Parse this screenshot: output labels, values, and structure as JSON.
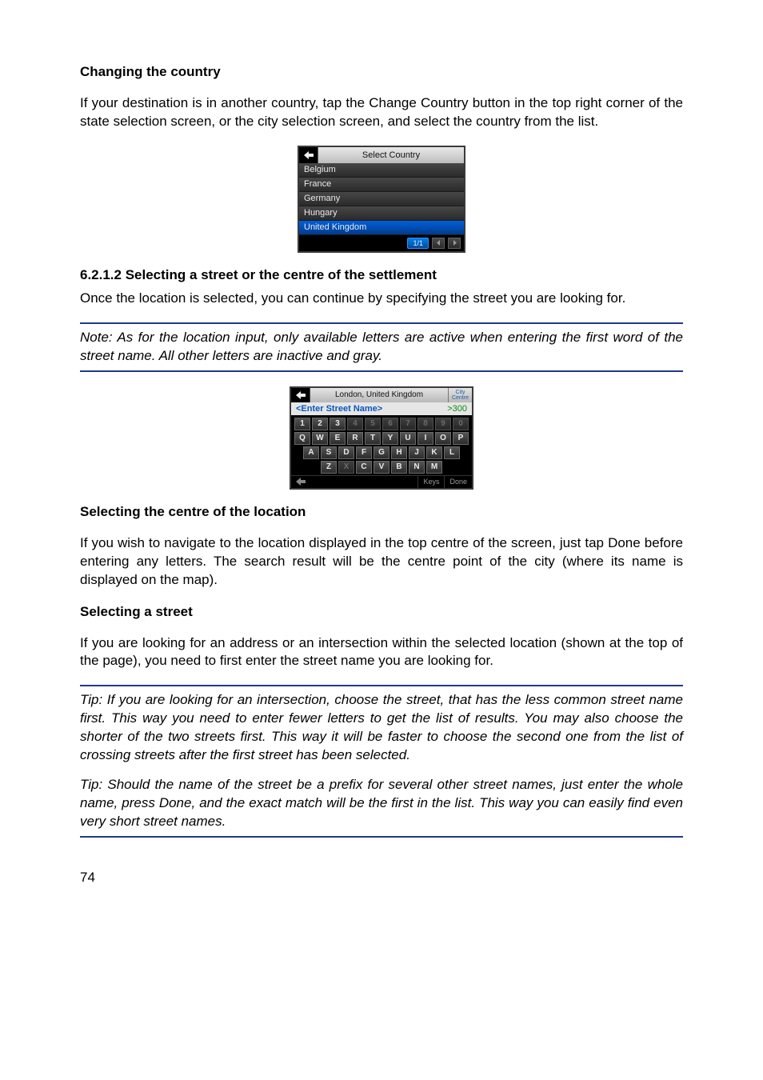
{
  "headings": {
    "changing_country": "Changing the country",
    "section_num": "6.2.1.2  Selecting a street or the centre of the settlement",
    "select_centre": "Selecting the centre of the location",
    "select_street": "Selecting a street"
  },
  "paragraphs": {
    "p1": "If your destination is in another country, tap the Change Country button in the top right corner of the state selection screen, or the city selection screen, and select the country from the list.",
    "p2": "Once the location is selected, you can continue by specifying the street you are looking for.",
    "note1": "Note: As for the location input, only available letters are active when entering the first word of the street name. All other letters are inactive and gray.",
    "p3": "If you wish to navigate to the location displayed in the top centre of the screen, just tap Done before entering any letters. The search result will be the centre point of the city (where its name is displayed on the map).",
    "p4": "If you are looking for an address or an intersection within the selected location (shown at the top of the page), you need to first enter the street name you are looking for.",
    "tip1": "Tip: If you are looking for an intersection, choose the street, that has the less common street name first. This way you need to enter fewer letters to get the list of results. You may also choose the shorter of the two streets first. This way it will be faster to choose the second one from the list of crossing streets after the first street has been selected.",
    "tip2": "Tip: Should the name of the street be a prefix for several other street names, just enter the whole name, press Done, and the exact match will be the first in the list. This way you can easily find even very short street names."
  },
  "select_country": {
    "title": "Select Country",
    "items": [
      "Belgium",
      "France",
      "Germany",
      "Hungary",
      "United Kingdom"
    ],
    "selected_index": 4,
    "page_indicator": "1/1"
  },
  "keyboard_screen": {
    "title": "London, United Kingdom",
    "centre_label_top": "City",
    "centre_label_bot": "Centre",
    "placeholder": "<Enter Street Name>",
    "result_count": ">300",
    "rows": {
      "numbers": [
        {
          "k": "1",
          "on": true
        },
        {
          "k": "2",
          "on": true
        },
        {
          "k": "3",
          "on": true
        },
        {
          "k": "4",
          "on": false
        },
        {
          "k": "5",
          "on": false
        },
        {
          "k": "6",
          "on": false
        },
        {
          "k": "7",
          "on": false
        },
        {
          "k": "8",
          "on": false
        },
        {
          "k": "9",
          "on": false
        },
        {
          "k": "0",
          "on": false
        }
      ],
      "r1": [
        {
          "k": "Q",
          "on": true
        },
        {
          "k": "W",
          "on": true
        },
        {
          "k": "E",
          "on": true
        },
        {
          "k": "R",
          "on": true
        },
        {
          "k": "T",
          "on": true
        },
        {
          "k": "Y",
          "on": true
        },
        {
          "k": "U",
          "on": true
        },
        {
          "k": "I",
          "on": true
        },
        {
          "k": "O",
          "on": true
        },
        {
          "k": "P",
          "on": true
        }
      ],
      "r2": [
        {
          "k": "A",
          "on": true
        },
        {
          "k": "S",
          "on": true
        },
        {
          "k": "D",
          "on": true
        },
        {
          "k": "F",
          "on": true
        },
        {
          "k": "G",
          "on": true
        },
        {
          "k": "H",
          "on": true
        },
        {
          "k": "J",
          "on": true
        },
        {
          "k": "K",
          "on": true
        },
        {
          "k": "L",
          "on": true
        }
      ],
      "r3": [
        {
          "k": "Z",
          "on": true
        },
        {
          "k": "X",
          "on": false
        },
        {
          "k": "C",
          "on": true
        },
        {
          "k": "V",
          "on": true
        },
        {
          "k": "B",
          "on": true
        },
        {
          "k": "N",
          "on": true
        },
        {
          "k": "M",
          "on": true
        }
      ]
    },
    "footer": {
      "keys": "Keys",
      "done": "Done"
    }
  },
  "page_number": "74"
}
